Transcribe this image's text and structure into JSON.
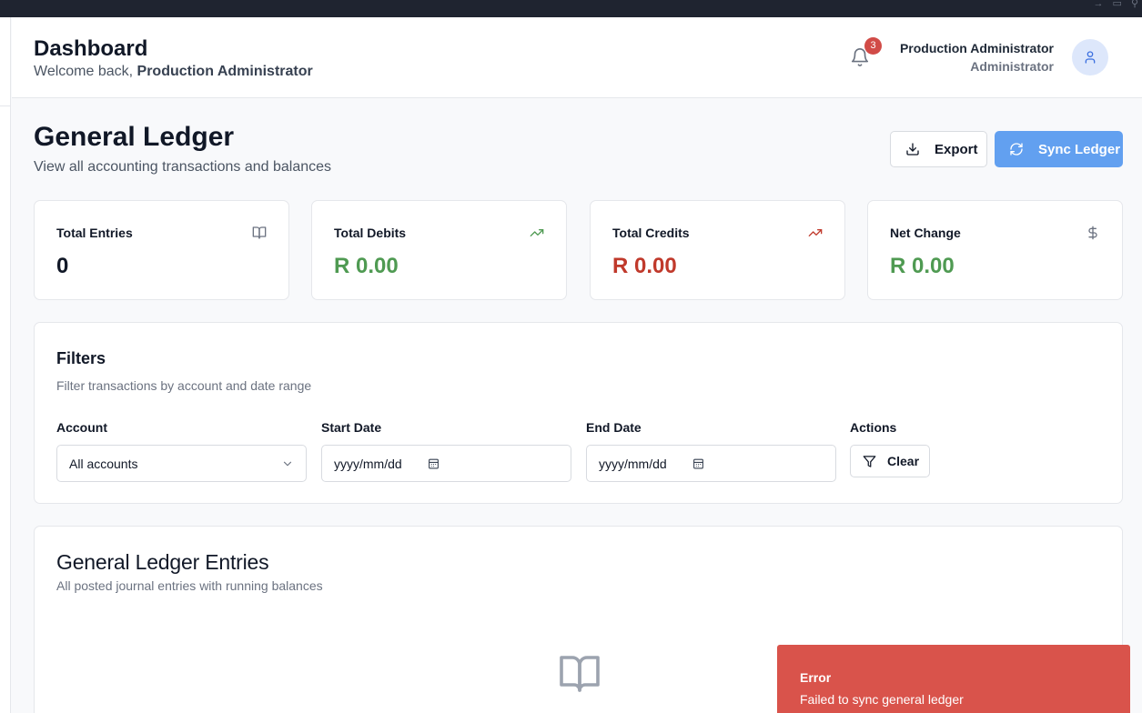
{
  "header": {
    "title": "Dashboard",
    "welcome_prefix": "Welcome back, ",
    "welcome_name": "Production Administrator",
    "notification_count": "3",
    "user_name": "Production Administrator",
    "user_role": "Administrator"
  },
  "page": {
    "title": "General Ledger",
    "subtitle": "View all accounting transactions and balances",
    "export_label": "Export",
    "sync_label": "Sync Ledger"
  },
  "stats": [
    {
      "label": "Total Entries",
      "value": "0",
      "icon": "book-open-icon",
      "color": "#111827"
    },
    {
      "label": "Total Debits",
      "value": "R 0.00",
      "icon": "trending-up-icon",
      "color": "#4f9a52"
    },
    {
      "label": "Total Credits",
      "value": "R 0.00",
      "icon": "trending-up-icon",
      "color": "#c0392b"
    },
    {
      "label": "Net Change",
      "value": "R 0.00",
      "icon": "dollar-icon",
      "color": "#4f9a52"
    }
  ],
  "filters": {
    "title": "Filters",
    "subtitle": "Filter transactions by account and date range",
    "account_label": "Account",
    "account_value": "All accounts",
    "start_label": "Start Date",
    "start_placeholder": "yyyy/mm/dd",
    "end_label": "End Date",
    "end_placeholder": "yyyy/mm/dd",
    "actions_label": "Actions",
    "clear_label": "Clear"
  },
  "entries": {
    "title": "General Ledger Entries",
    "subtitle": "All posted journal entries with running balances"
  },
  "toast": {
    "title": "Error",
    "message": "Failed to sync general ledger"
  }
}
